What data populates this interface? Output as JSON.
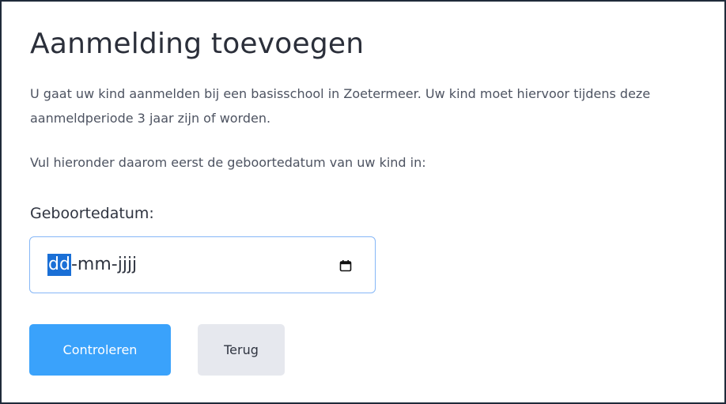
{
  "page": {
    "title": "Aanmelding toevoegen",
    "intro": "U gaat uw kind aanmelden bij een basisschool in Zoetermeer. Uw kind moet hiervoor tijdens deze aanmeldperiode 3 jaar zijn of worden.",
    "instruction": "Vul hieronder daarom eerst de geboortedatum van uw kind in:"
  },
  "form": {
    "birthdate_label": "Geboortedatum:",
    "date_input": {
      "day_placeholder": "dd",
      "separator_1": "-",
      "month_placeholder": "mm",
      "separator_2": "-",
      "year_placeholder": "jjjj",
      "icon": "calendar-icon"
    }
  },
  "actions": {
    "check_label": "Controleren",
    "back_label": "Terug"
  },
  "colors": {
    "primary_button": "#3aa2fb",
    "secondary_button": "#e6e8ee",
    "input_focus_border": "#86b7f7",
    "selection": "#1a6fd6",
    "frame_border": "#1f2a3a"
  }
}
